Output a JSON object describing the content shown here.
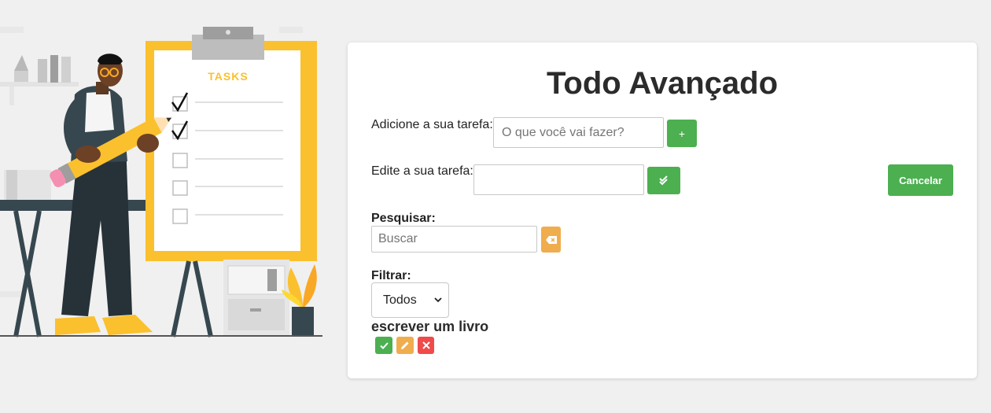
{
  "illustration": {
    "board_heading": "TASKS"
  },
  "form": {
    "title": "Todo Avançado",
    "add_label": "Adicione a sua tarefa:",
    "add_placeholder": "O que você vai fazer?",
    "add_button": "+",
    "edit_label": "Edite a sua tarefa:",
    "edit_value": "",
    "cancel_button": "Cancelar",
    "search_label": "Pesquisar:",
    "search_placeholder": "Buscar",
    "filter_label": "Filtrar:",
    "filter_selected": "Todos"
  },
  "todos": [
    {
      "title": "escrever um livro"
    }
  ],
  "colors": {
    "green": "#4caf50",
    "orange": "#f0ad4e",
    "red": "#ef4b4b",
    "board_yellow": "#fbc02d"
  }
}
